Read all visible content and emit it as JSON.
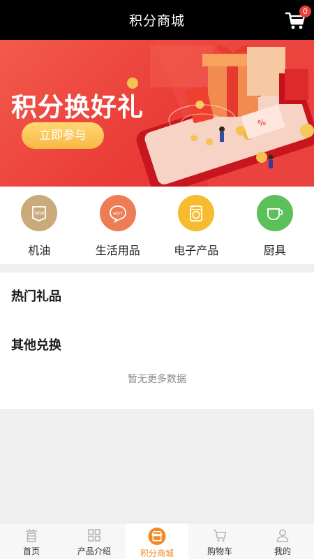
{
  "header": {
    "title": "积分商城",
    "cart_count": "0",
    "cart_icon": "cart-icon"
  },
  "banner": {
    "title": "积分换好礼",
    "button_label": "立即参与",
    "colors": {
      "background": "#ea3b37",
      "button": "#f7b745"
    }
  },
  "categories": [
    {
      "label": "机油",
      "icon": "oil-tag-icon",
      "color": "#c9a878"
    },
    {
      "label": "生活用品",
      "icon": "hot-chat-icon",
      "color": "#ee7d55"
    },
    {
      "label": "电子产品",
      "icon": "washing-machine-icon",
      "color": "#f6bb2e"
    },
    {
      "label": "厨具",
      "icon": "cup-icon",
      "color": "#5cc05a"
    }
  ],
  "sections": {
    "hot_gifts": "热门礼品",
    "other_exchange": "其他兑换",
    "empty_text": "暂无更多数据"
  },
  "tabbar": {
    "items": [
      {
        "label": "首页",
        "icon": "home-icon"
      },
      {
        "label": "产品介绍",
        "icon": "grid-icon"
      },
      {
        "label": "积分商城",
        "icon": "shop-icon",
        "active": true
      },
      {
        "label": "购物车",
        "icon": "cart-icon"
      },
      {
        "label": "我的",
        "icon": "user-icon"
      }
    ],
    "active_color": "#f08a24"
  }
}
